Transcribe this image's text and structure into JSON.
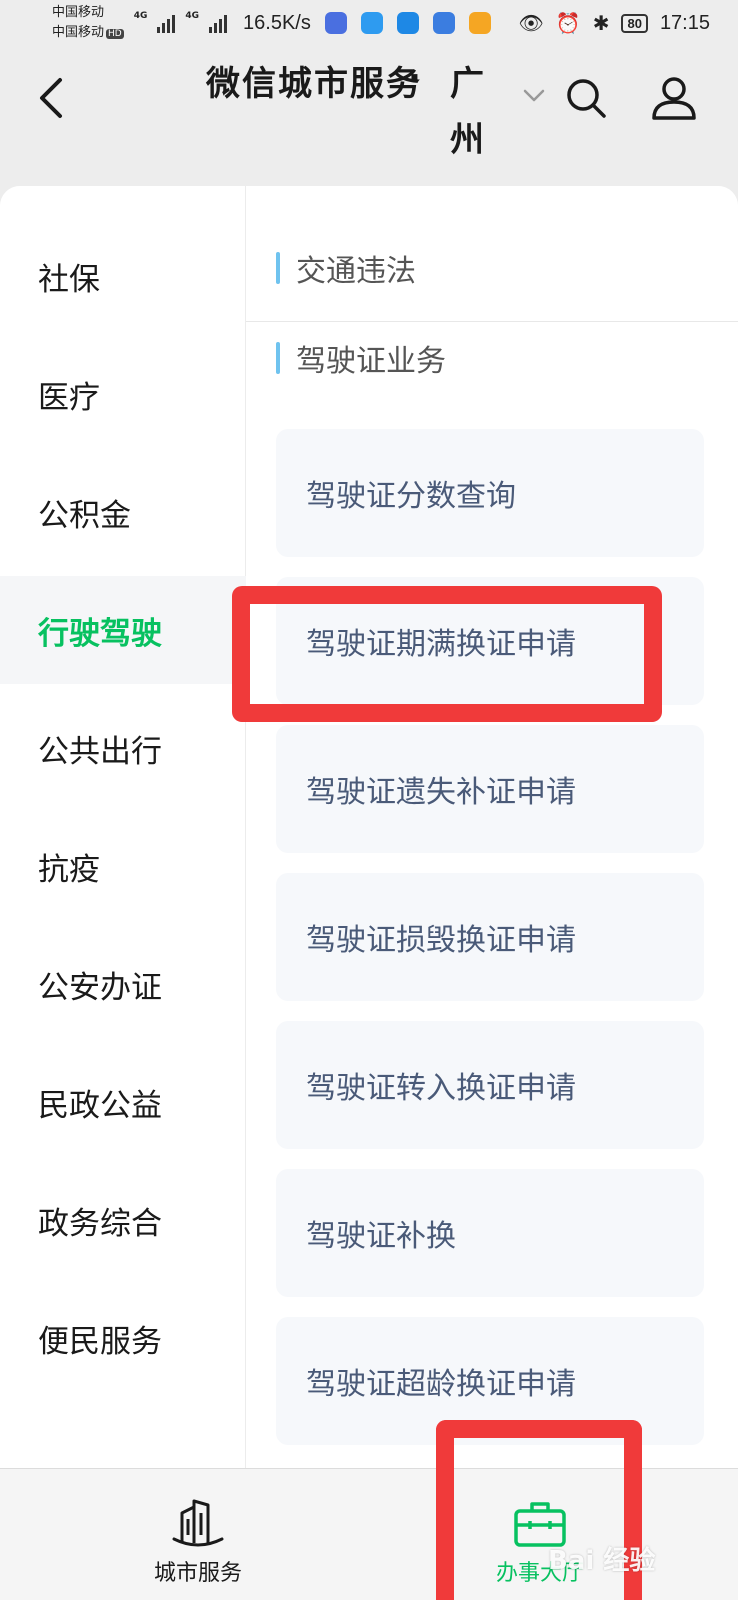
{
  "status_bar": {
    "carrier_1": "中国移动",
    "carrier_2": "中国移动",
    "hd_badge": "HD",
    "network_1": "4G",
    "network_2": "4G",
    "speed": "16.5K/s",
    "battery": "80",
    "time": "17:15"
  },
  "header": {
    "title": "微信城市服务",
    "separator": "·",
    "city": "广州"
  },
  "sidebar": {
    "items": [
      {
        "label": "社保"
      },
      {
        "label": "医疗"
      },
      {
        "label": "公积金"
      },
      {
        "label": "行驶驾驶",
        "active": true
      },
      {
        "label": "公共出行"
      },
      {
        "label": "抗疫"
      },
      {
        "label": "公安办证"
      },
      {
        "label": "民政公益"
      },
      {
        "label": "政务综合"
      },
      {
        "label": "便民服务"
      }
    ]
  },
  "main": {
    "sections": [
      {
        "title": "交通违法"
      },
      {
        "title": "驾驶证业务"
      }
    ],
    "services": [
      {
        "label": "驾驶证分数查询"
      },
      {
        "label": "驾驶证期满换证申请"
      },
      {
        "label": "驾驶证遗失补证申请"
      },
      {
        "label": "驾驶证损毁换证申请"
      },
      {
        "label": "驾驶证转入换证申请"
      },
      {
        "label": "驾驶证补换"
      },
      {
        "label": "驾驶证超龄换证申请"
      }
    ]
  },
  "tabbar": {
    "tabs": [
      {
        "label": "城市服务",
        "icon": "city-buildings-icon"
      },
      {
        "label": "办事大厅",
        "icon": "briefcase-icon",
        "active": true
      }
    ]
  },
  "watermark": {
    "text": "Bai 经验"
  },
  "colors": {
    "accent_green": "#07c160",
    "annotation_red": "#f03a3a",
    "section_bar_blue": "#6fc3ef",
    "service_text": "#4a5a78"
  }
}
